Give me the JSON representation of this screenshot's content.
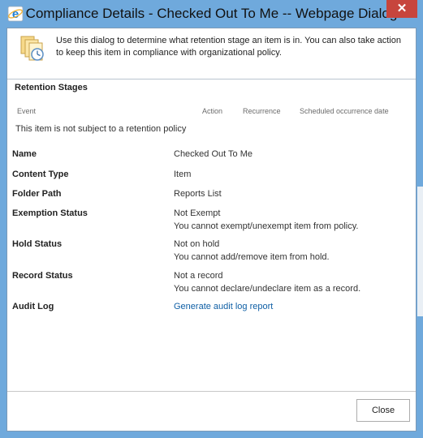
{
  "window": {
    "title": "Compliance Details - Checked Out To Me -- Webpage Dialog",
    "close_glyph": "✕"
  },
  "intro": {
    "text": "Use this dialog to determine what retention stage an item is in. You can also take action to keep this item in compliance with organizational policy."
  },
  "retention": {
    "title": "Retention Stages",
    "columns": [
      "Event",
      "Action",
      "Recurrence",
      "Scheduled occurrence date"
    ],
    "empty_message": "This item is not subject to a retention policy"
  },
  "details": {
    "name_label": "Name",
    "name_value": "Checked Out To Me",
    "content_type_label": "Content Type",
    "content_type_value": "Item",
    "folder_path_label": "Folder Path",
    "folder_path_value": "Reports List",
    "exemption_label": "Exemption Status",
    "exemption_value": "Not Exempt",
    "exemption_note": "You cannot exempt/unexempt item from policy.",
    "hold_label": "Hold Status",
    "hold_value": "Not on hold",
    "hold_note": "You cannot add/remove item from hold.",
    "record_label": "Record Status",
    "record_value": "Not a record",
    "record_note": "You cannot declare/undeclare item as a record.",
    "audit_label": "Audit Log",
    "audit_link": "Generate audit log report"
  },
  "footer": {
    "close_label": "Close"
  },
  "icons": {
    "app": "ie-icon",
    "intro": "compliance-documents-clock-icon"
  },
  "colors": {
    "titlebar": "#6fa9dc",
    "close_button": "#c7453d",
    "link": "#0f5fa5"
  }
}
